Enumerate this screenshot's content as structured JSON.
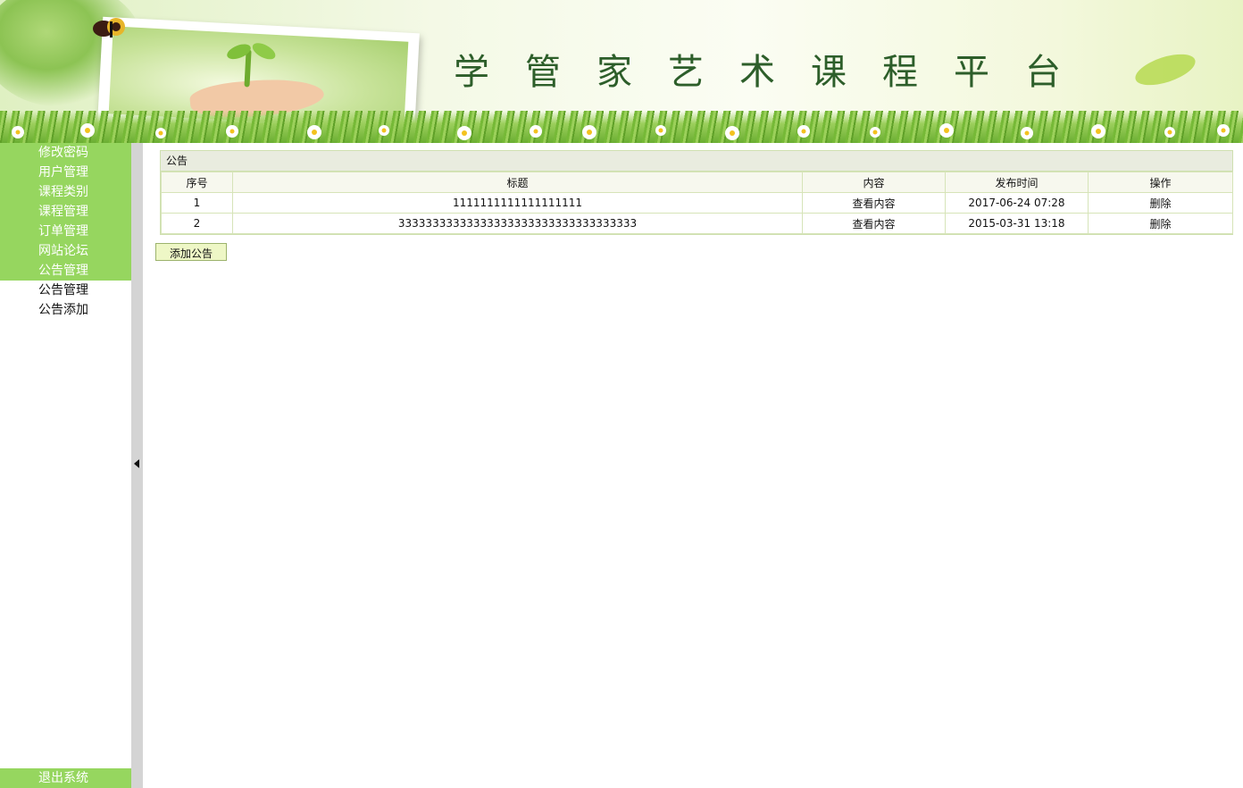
{
  "banner": {
    "title": "学管家艺术课程平台"
  },
  "sidebar": {
    "menu": [
      {
        "label": "修改密码"
      },
      {
        "label": "用户管理"
      },
      {
        "label": "课程类别"
      },
      {
        "label": "课程管理"
      },
      {
        "label": "订单管理"
      },
      {
        "label": "网站论坛"
      },
      {
        "label": "公告管理"
      }
    ],
    "submenu": [
      {
        "label": "公告管理"
      },
      {
        "label": "公告添加"
      }
    ],
    "logout": "退出系统"
  },
  "panel": {
    "title": "公告",
    "columns": [
      "序号",
      "标题",
      "内容",
      "发布时间",
      "操作"
    ],
    "rows": [
      {
        "no": "1",
        "title": "1111111111111111111",
        "content": "查看内容",
        "time": "2017-06-24 07:28",
        "action": "删除"
      },
      {
        "no": "2",
        "title": "33333333333333333333333333333333333",
        "content": "查看内容",
        "time": "2015-03-31 13:18",
        "action": "删除"
      }
    ]
  },
  "add_button": "添加公告",
  "colors": {
    "menu_green": "#96d65f",
    "title_green": "#2d5e2a"
  }
}
